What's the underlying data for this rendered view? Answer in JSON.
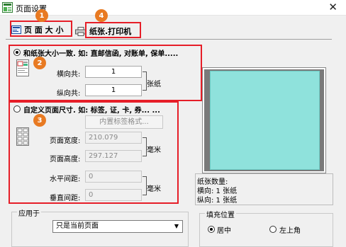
{
  "window": {
    "title": "页面设置",
    "close_glyph": "✕"
  },
  "tabs": [
    {
      "label": "页 面 大 小",
      "badge": "1"
    },
    {
      "label": "纸张.打印机",
      "badge": "4"
    }
  ],
  "option_fit": {
    "label": "和纸张大小一致. 如: 直邮信函, 对账单, 保单.....",
    "badge": "2",
    "horizontal_label": "横向共:",
    "horizontal_value": "1",
    "vertical_label": "纵向共:",
    "vertical_value": "1",
    "unit": "张纸"
  },
  "option_custom": {
    "label": "自定义页面尺寸. 如: 标签, 证, 卡, 券... ...",
    "badge": "3",
    "builtin_label_button": "内置标签格式...",
    "page_width_label": "页面宽度:",
    "page_width_value": "210.079",
    "page_height_label": "页面高度:",
    "page_height_value": "297.127",
    "size_unit": "毫米",
    "h_spacing_label": "水平间距:",
    "h_spacing_value": "0",
    "v_spacing_label": "垂直间距:",
    "v_spacing_value": "0",
    "spacing_unit": "毫米"
  },
  "paper_info": {
    "line1": "纸张数量:",
    "line2": "横向: 1 张纸",
    "line3": "纵向: 1 张纸"
  },
  "apply_to": {
    "group_label": "应用于",
    "selected": "只是当前页面"
  },
  "fill_position": {
    "group_label": "填充位置",
    "center_label": "居中",
    "topleft_label": "左上角"
  },
  "colors": {
    "highlight_red": "#e61e28",
    "badge_orange": "#e87a22",
    "preview_cyan": "#8fe2dc"
  }
}
